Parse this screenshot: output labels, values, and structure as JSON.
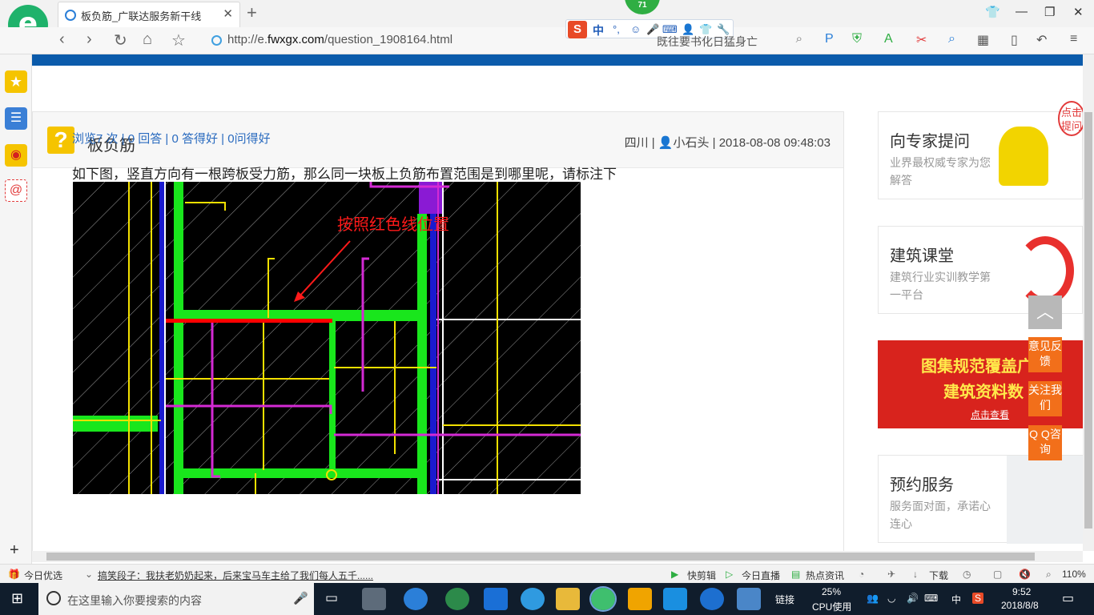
{
  "browser": {
    "tab_title": "板负筋_广联达服务新干线",
    "url_prefix": "http://e.",
    "url_domain": "fwxgx.com",
    "url_path": "/question_1908164.html",
    "search_text": "既往要书化日猛身亡",
    "ime_label": "中",
    "ime_badge": "71",
    "logo_glyph": "e"
  },
  "question": {
    "title": "板负筋",
    "meta": "四川 | 👤小石头 | 2018-08-08 09:48:03",
    "stats": "浏览7 次 | 0 回答 | 0 答得好 | 0问得好",
    "body": "如下图，竖直方向有一根跨板受力筋，那么同一块板上负筋布置范围是到哪里呢，请标注下",
    "annotation": "按照红色线位置"
  },
  "sidebar_right": {
    "expert": {
      "heading": "向专家提问",
      "desc": "业界最权威专家为您解答",
      "bubble": "点击提问"
    },
    "course": {
      "heading": "建筑课堂",
      "desc": "建筑行业实训教学第一平台"
    },
    "banner": {
      "line1": "图集规范覆盖广",
      "line2": "建筑资料数",
      "cta": "点击查看"
    },
    "booking": {
      "heading": "预约服务",
      "desc": "服务面对面，承诺心连心"
    }
  },
  "float_buttons": {
    "feedback": "意见反馈",
    "follow": "关注我们",
    "qq": "Q Q咨询"
  },
  "statusbar": {
    "today": "今日优选",
    "news": "搞笑段子：我扶老奶奶起来，后来宝马车主给了我们每人五千......",
    "quickcut": "快剪辑",
    "live": "今日直播",
    "hot": "热点资讯",
    "download": "下载",
    "zoom": "110%"
  },
  "taskbar": {
    "search_placeholder": "在这里输入你要搜索的内容",
    "links": "链接",
    "cpu_percent": "25%",
    "cpu_label": "CPU使用",
    "ime": "中",
    "time": "9:52",
    "date": "2018/8/8"
  },
  "colors": {
    "brand_blue": "#0b5bab",
    "accent_orange": "#f26f1a",
    "cad_green": "#19e61c",
    "cad_magenta": "#d42ad4",
    "cad_yellow": "#f2e000",
    "cad_red": "#ff0000"
  }
}
